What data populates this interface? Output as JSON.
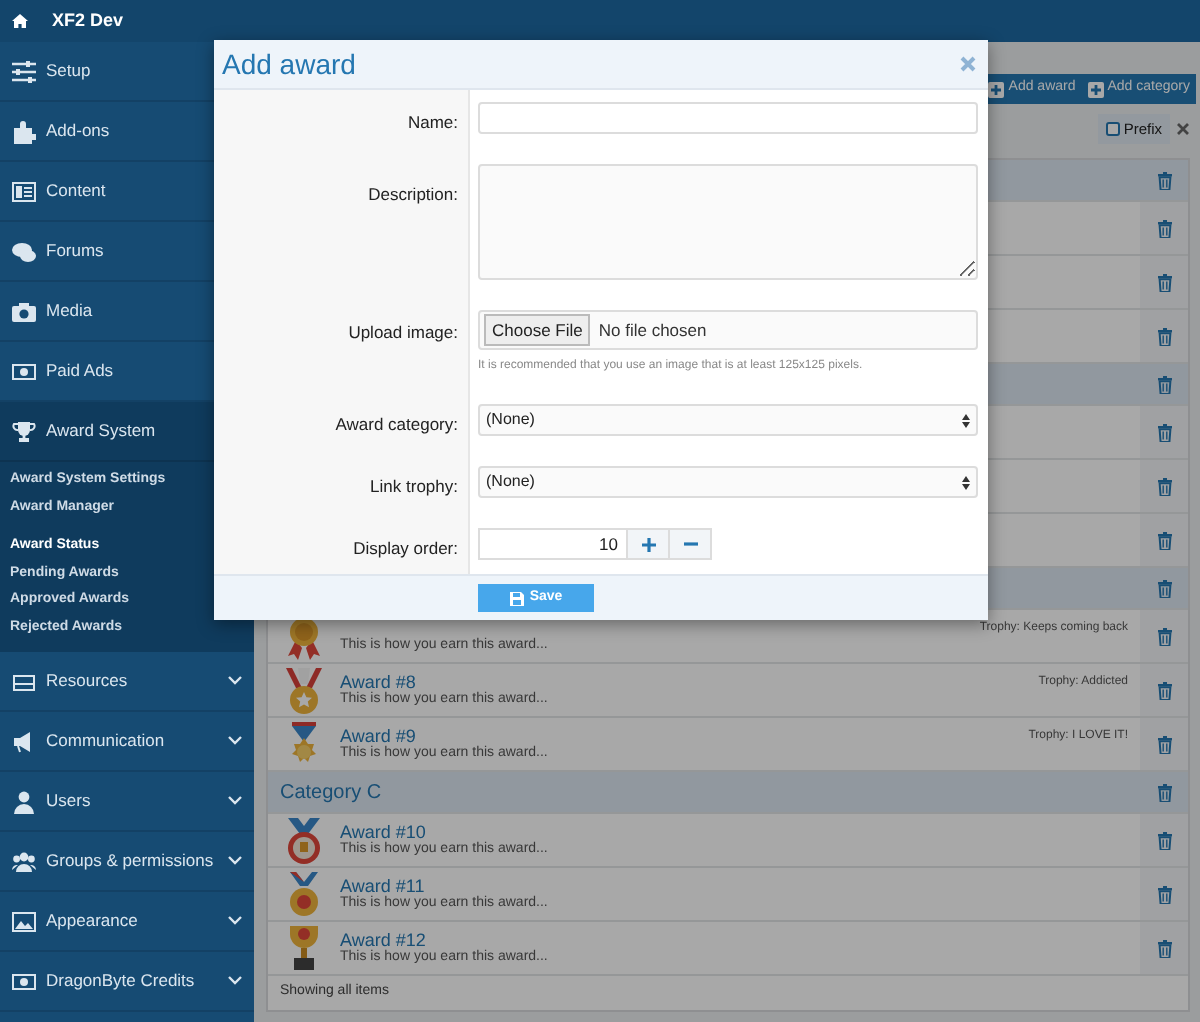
{
  "topbar": {
    "title": "XF2 Dev"
  },
  "sidebar": {
    "items": [
      {
        "label": "Setup"
      },
      {
        "label": "Add-ons"
      },
      {
        "label": "Content"
      },
      {
        "label": "Forums"
      },
      {
        "label": "Media"
      },
      {
        "label": "Paid Ads"
      },
      {
        "label": "Award System",
        "expanded": true,
        "children": [
          {
            "kind": "link",
            "label": "Award System Settings"
          },
          {
            "kind": "link",
            "label": "Award Manager"
          },
          {
            "kind": "heading",
            "label": "Award Status"
          },
          {
            "kind": "link",
            "label": "Pending Awards"
          },
          {
            "kind": "link",
            "label": "Approved Awards"
          },
          {
            "kind": "link",
            "label": "Rejected Awards"
          }
        ]
      },
      {
        "label": "Resources",
        "expanded": false
      },
      {
        "label": "Communication",
        "expanded": false
      },
      {
        "label": "Users",
        "expanded": false
      },
      {
        "label": "Groups & permissions",
        "expanded": false
      },
      {
        "label": "Appearance",
        "expanded": false
      },
      {
        "label": "DragonByte Credits",
        "expanded": false
      }
    ]
  },
  "toolbar": {
    "buttons": [
      "Add award",
      "Add category"
    ]
  },
  "filter": {
    "prefix": {
      "label": "Prefix",
      "checked": false
    }
  },
  "list": {
    "rows": [
      {
        "kind": "category"
      },
      {
        "kind": "award"
      },
      {
        "kind": "award"
      },
      {
        "kind": "award"
      },
      {
        "kind": "category"
      },
      {
        "kind": "award"
      },
      {
        "kind": "award"
      },
      {
        "kind": "award"
      },
      {
        "kind": "category"
      },
      {
        "kind": "award",
        "description": "This is how you earn this award...",
        "trophy": "Trophy: Keeps coming back"
      },
      {
        "kind": "award",
        "title": "Award #8",
        "description": "This is how you earn this award...",
        "trophy": "Trophy: Addicted"
      },
      {
        "kind": "award",
        "title": "Award #9",
        "description": "This is how you earn this award...",
        "trophy": "Trophy: I LOVE IT!"
      },
      {
        "kind": "category",
        "title": "Category C"
      },
      {
        "kind": "award",
        "title": "Award #10",
        "description": "This is how you earn this award..."
      },
      {
        "kind": "award",
        "title": "Award #11",
        "description": "This is how you earn this award..."
      },
      {
        "kind": "award",
        "title": "Award #12",
        "description": "This is how you earn this award..."
      }
    ],
    "footer": "Showing all items"
  },
  "modal": {
    "title": "Add award",
    "fields": [
      {
        "kind": "text",
        "label": "Name:"
      },
      {
        "kind": "textarea",
        "label": "Description:"
      },
      {
        "kind": "file",
        "label": "Upload image:",
        "button": "Choose File",
        "value": "No file chosen",
        "hint": "It is recommended that you use an image that is at least 125x125 pixels."
      },
      {
        "kind": "select",
        "label": "Award category:",
        "value": "(None)"
      },
      {
        "kind": "select",
        "label": "Link trophy:",
        "value": "(None)"
      },
      {
        "kind": "number",
        "label": "Display order:",
        "value": "10"
      }
    ],
    "submit": "Save"
  }
}
